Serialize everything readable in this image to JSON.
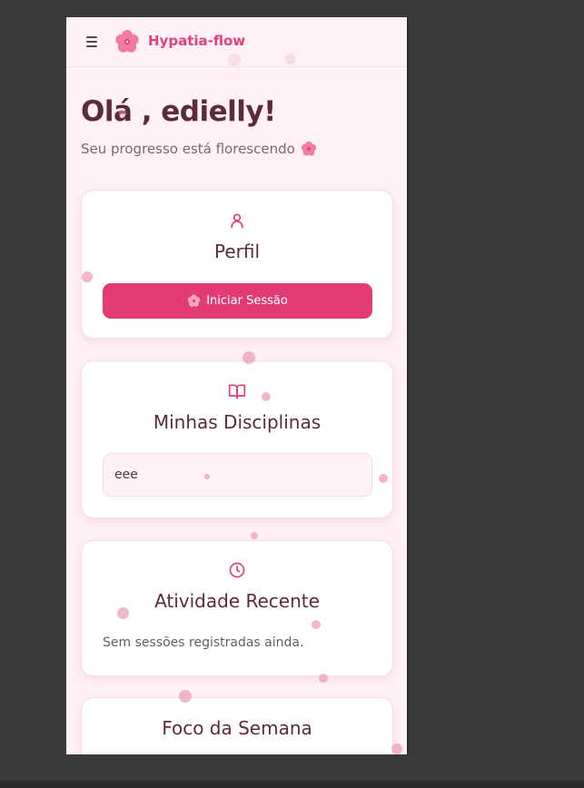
{
  "header": {
    "brand": "Hypatia-flow",
    "menu_icon": "hamburger-menu-icon",
    "logo_icon": "cherry-blossom-icon"
  },
  "greeting": {
    "title": "Olá , edielly!",
    "subtitle": "Seu progresso está florescendo",
    "subtitle_icon": "cherry-blossom-icon"
  },
  "profile_card": {
    "icon": "user-icon",
    "title": "Perfil",
    "button_label": "Iniciar Sessão",
    "button_icon": "cherry-blossom-icon"
  },
  "disciplines_card": {
    "icon": "book-open-icon",
    "title": "Minhas Disciplinas",
    "input_value": "eee"
  },
  "activity_card": {
    "icon": "clock-icon",
    "title": "Atividade Recente",
    "empty_text": "Sem sessões registradas ainda."
  },
  "focus_card": {
    "title": "Foco da Semana"
  },
  "colors": {
    "accent": "#e23c76",
    "brand_text": "#e0427a",
    "heading": "#5b2a3e",
    "background": "#fff1f5"
  }
}
